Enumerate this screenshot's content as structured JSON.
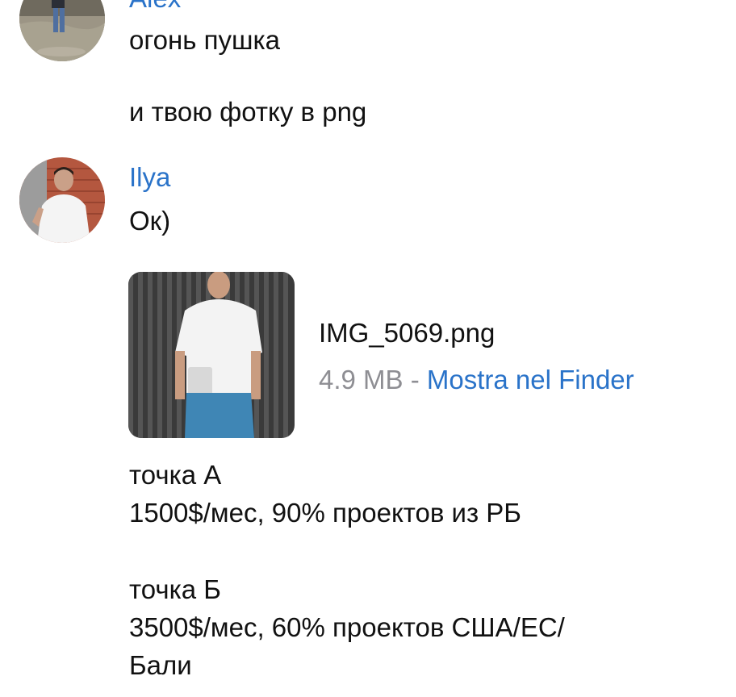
{
  "messages": [
    {
      "sender": "Alex",
      "avatar_icon": "person-photo-avatar",
      "texts": [
        "огонь пушка",
        "и твою фотку в png"
      ]
    },
    {
      "sender": "Ilya",
      "avatar_icon": "person-photo-avatar",
      "texts": [
        "Ок)"
      ],
      "attachment": {
        "file_name": "IMG_5069.png",
        "size": "4.9 MB",
        "separator": " - ",
        "action_label": "Mostra nel Finder",
        "thumbnail_icon": "photo-thumbnail"
      },
      "blocks": [
        {
          "lines": [
            "точка А",
            "1500$/мес, 90% проектов из РБ"
          ]
        },
        {
          "lines": [
            "точка Б",
            "3500$/мес, 60% проектов США/ЕС/",
            "Бали"
          ]
        }
      ]
    }
  ],
  "colors": {
    "sender_name": "#2a73c9",
    "link": "#2a73c9",
    "meta_gray": "#8e8e93",
    "text": "#111111",
    "background": "#ffffff"
  }
}
